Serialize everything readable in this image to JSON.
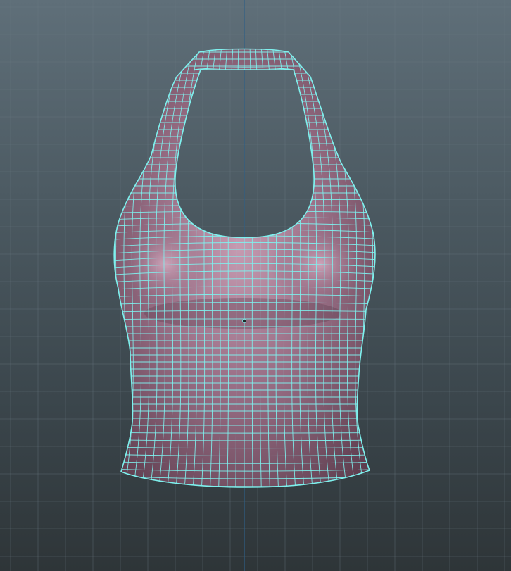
{
  "viewport": {
    "background_top": "#5f6f79",
    "background_bottom": "#2e3538",
    "grid_color": "#6b7a83",
    "axis_color": "#2f5f86"
  },
  "mesh": {
    "object": "halter-top",
    "surface_color": "#9a6f86",
    "surface_highlight": "#c69bb1",
    "surface_shadow": "#5d3d4e",
    "wire_color": "#7ef1ee"
  },
  "icons": [
    "pivot-icon"
  ]
}
